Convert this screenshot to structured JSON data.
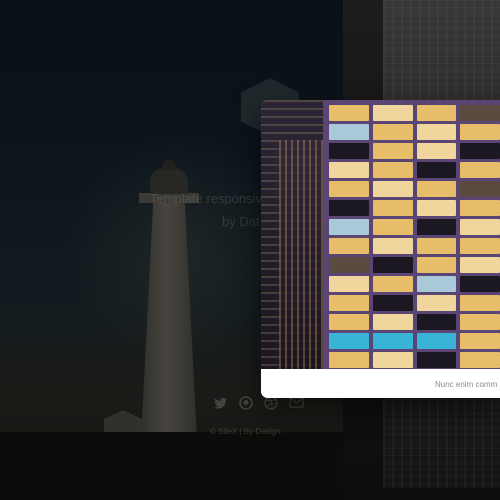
{
  "hero": {
    "tagline": "Template responsive",
    "credit": "by Dat",
    "social_icons": [
      "twitter-icon",
      "github-icon",
      "dribbble-icon",
      "mail-icon"
    ],
    "footer": "© SiteX  |  By Design ..."
  },
  "lightbox": {
    "caption": "Nunc enim comm"
  },
  "colors": {
    "facade": "#5b4575",
    "window_lit": "#e8bd6a",
    "caption_text": "#8a8a8a"
  }
}
